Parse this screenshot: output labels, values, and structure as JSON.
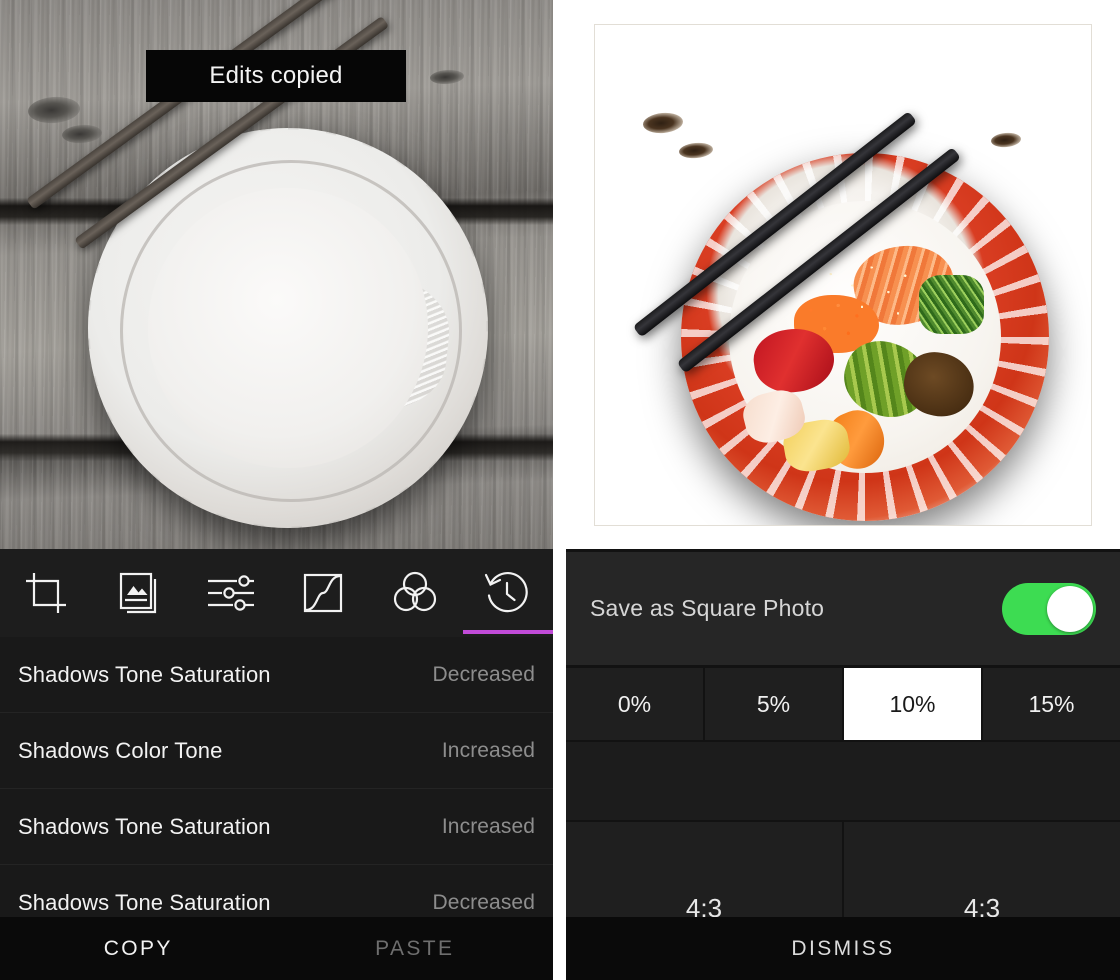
{
  "left_panel": {
    "toast": {
      "message": "Edits copied"
    },
    "toolbar": {
      "tools": [
        {
          "name": "crop-tool",
          "icon": "crop-icon",
          "selected": false
        },
        {
          "name": "frames-tool",
          "icon": "frames-icon",
          "selected": false
        },
        {
          "name": "adjust-tool",
          "icon": "sliders-icon",
          "selected": false
        },
        {
          "name": "curves-tool",
          "icon": "curve-icon",
          "selected": false
        },
        {
          "name": "color-tool",
          "icon": "color-circles-icon",
          "selected": false
        },
        {
          "name": "history-tool",
          "icon": "history-clock-icon",
          "selected": true
        }
      ],
      "accent_color": "#c14bd8"
    },
    "history": {
      "rows": [
        {
          "name": "Shadows Tone Saturation",
          "value": "Decreased"
        },
        {
          "name": "Shadows Color Tone",
          "value": "Increased"
        },
        {
          "name": "Shadows Tone Saturation",
          "value": "Increased"
        },
        {
          "name": "Shadows Tone Saturation",
          "value": "Decreased"
        }
      ]
    },
    "bottom_bar": {
      "copy_label": "COPY",
      "paste_label": "PASTE"
    }
  },
  "right_panel": {
    "settings": {
      "toggle_label": "Save as Square Photo",
      "toggle_on": true,
      "toggle_color": "#3ddc52",
      "percent_options": [
        {
          "label": "0%",
          "selected": false
        },
        {
          "label": "5%",
          "selected": false
        },
        {
          "label": "10%",
          "selected": true
        },
        {
          "label": "15%",
          "selected": false
        }
      ],
      "partial_row": [
        {
          "label": "4:3"
        },
        {
          "label": "4:3"
        }
      ]
    },
    "bottom_bar": {
      "dismiss_label": "DISMISS"
    }
  }
}
